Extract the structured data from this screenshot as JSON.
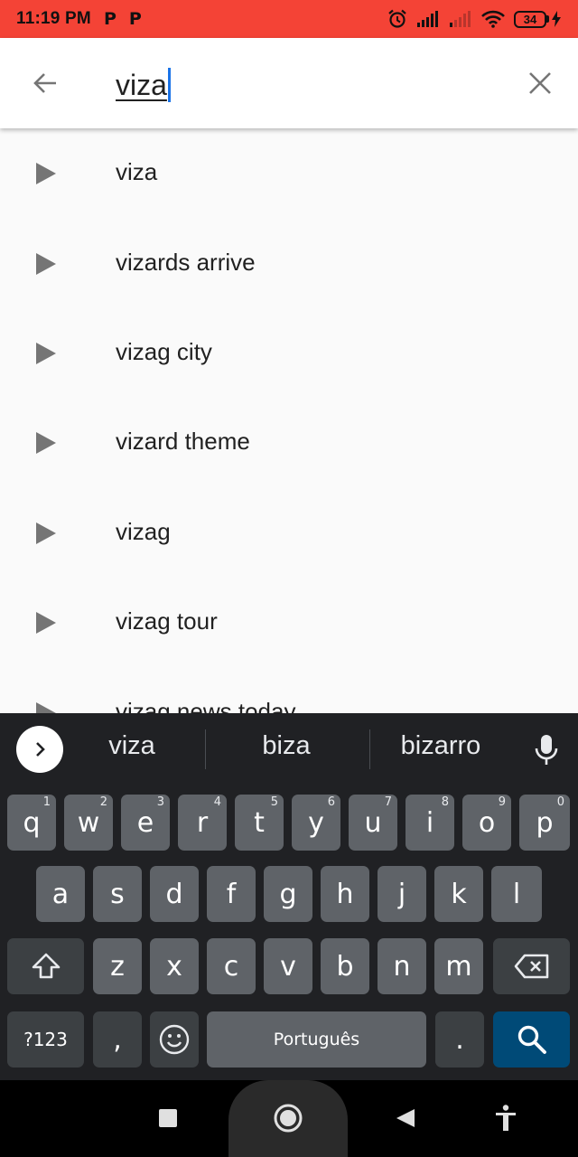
{
  "status_bar": {
    "time": "11:19 PM",
    "notification_icons": [
      "P",
      "P"
    ],
    "battery_level": "34",
    "background": "#f44336"
  },
  "search": {
    "query": "viza",
    "back_icon": "arrow-left-icon",
    "clear_icon": "close-icon"
  },
  "suggestions": [
    "viza",
    "vizards arrive",
    "vizag city",
    "vizard theme",
    "vizag",
    "vizag tour",
    "vizag news today"
  ],
  "keyboard": {
    "word_suggestions": [
      "viza",
      "biza",
      "bizarro"
    ],
    "rows": [
      [
        {
          "key": "q",
          "hint": "1"
        },
        {
          "key": "w",
          "hint": "2"
        },
        {
          "key": "e",
          "hint": "3"
        },
        {
          "key": "r",
          "hint": "4"
        },
        {
          "key": "t",
          "hint": "5"
        },
        {
          "key": "y",
          "hint": "6"
        },
        {
          "key": "u",
          "hint": "7"
        },
        {
          "key": "i",
          "hint": "8"
        },
        {
          "key": "o",
          "hint": "9"
        },
        {
          "key": "p",
          "hint": "0"
        }
      ],
      [
        {
          "key": "a"
        },
        {
          "key": "s"
        },
        {
          "key": "d"
        },
        {
          "key": "f"
        },
        {
          "key": "g"
        },
        {
          "key": "h"
        },
        {
          "key": "j"
        },
        {
          "key": "k"
        },
        {
          "key": "l"
        }
      ],
      [
        {
          "key": "z"
        },
        {
          "key": "x"
        },
        {
          "key": "c"
        },
        {
          "key": "v"
        },
        {
          "key": "b"
        },
        {
          "key": "n"
        },
        {
          "key": "m"
        }
      ]
    ],
    "symbols_key": "?123",
    "comma_key": ",",
    "space_label": "Português",
    "period_key": ".",
    "accent_color": "#004a77"
  }
}
